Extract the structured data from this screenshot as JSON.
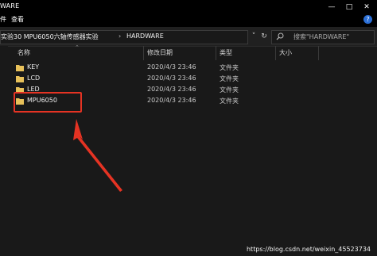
{
  "window": {
    "title": "WARE",
    "min_glyph": "—",
    "max_glyph": "□",
    "close_glyph": "✕"
  },
  "menu": {
    "left_glyph": "件",
    "view": "查看"
  },
  "address": {
    "crumbs": [
      "实验30 MPU6050六轴传感器实验",
      "HARDWARE"
    ],
    "separator": "›"
  },
  "search": {
    "placeholder": "搜索\"HARDWARE\""
  },
  "columns": {
    "name": "名称",
    "date": "修改日期",
    "type": "类型",
    "size": "大小"
  },
  "files": [
    {
      "name": "KEY",
      "date": "2020/4/3 23:46",
      "type": "文件夹"
    },
    {
      "name": "LCD",
      "date": "2020/4/3 23:46",
      "type": "文件夹"
    },
    {
      "name": "LED",
      "date": "2020/4/3 23:46",
      "type": "文件夹"
    },
    {
      "name": "MPU6050",
      "date": "2020/4/3 23:46",
      "type": "文件夹"
    }
  ],
  "annotation_color": "#e53323",
  "folder_color": "#e8c15a",
  "watermark": "https://blog.csdn.net/weixin_45523734"
}
